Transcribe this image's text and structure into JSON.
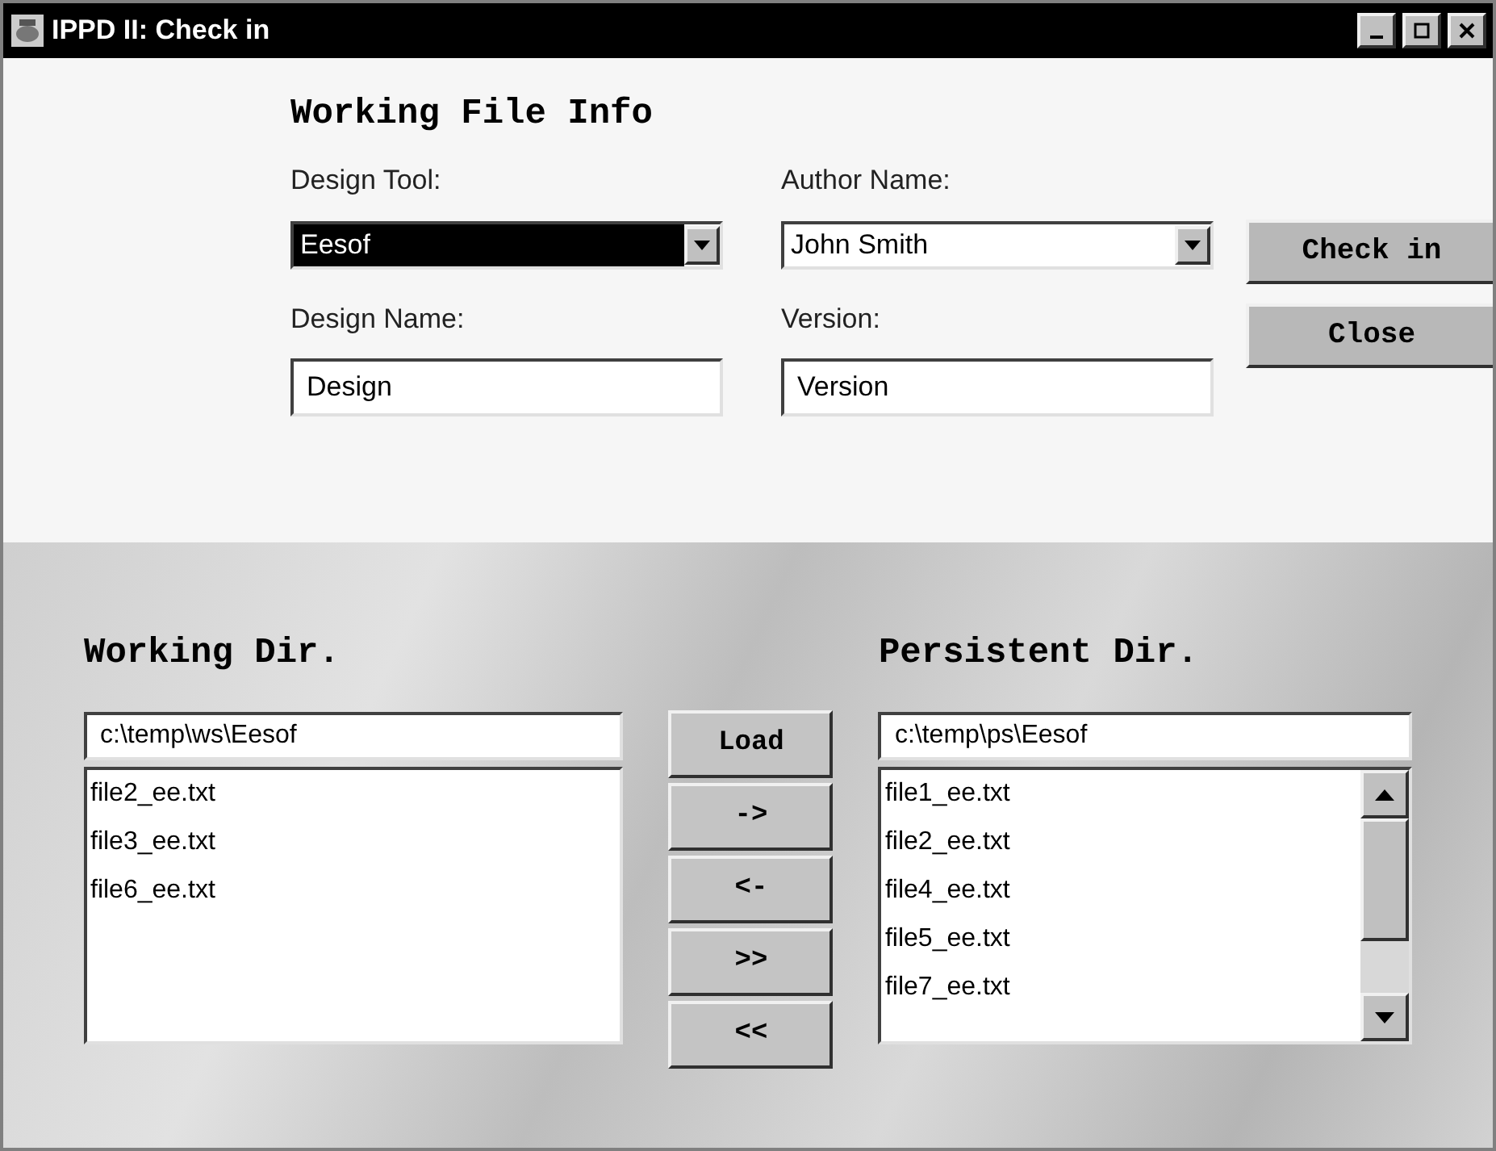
{
  "window": {
    "title": "IPPD II: Check in"
  },
  "file_info": {
    "heading": "Working File Info",
    "fields": [
      {
        "kind": "combo",
        "label": "Design Tool:",
        "value": "Eesof",
        "highlighted": true
      },
      {
        "kind": "combo",
        "label": "Author Name:",
        "value": "John Smith",
        "highlighted": false
      },
      {
        "kind": "text",
        "label": "Design Name:",
        "value": "Design"
      },
      {
        "kind": "text",
        "label": "Version:",
        "value": "Version"
      }
    ],
    "buttons": [
      "Check in",
      "Close"
    ]
  },
  "working_dir": {
    "heading": "Working Dir.",
    "path": "c:\\temp\\ws\\Eesof",
    "files": [
      "file2_ee.txt",
      "file3_ee.txt",
      "file6_ee.txt"
    ]
  },
  "transfer_buttons": [
    "Load",
    "->",
    "<-",
    ">>",
    "<<"
  ],
  "persistent_dir": {
    "heading": "Persistent Dir.",
    "path": "c:\\temp\\ps\\Eesof",
    "files": [
      "file1_ee.txt",
      "file2_ee.txt",
      "file4_ee.txt",
      "file5_ee.txt",
      "file7_ee.txt"
    ]
  }
}
